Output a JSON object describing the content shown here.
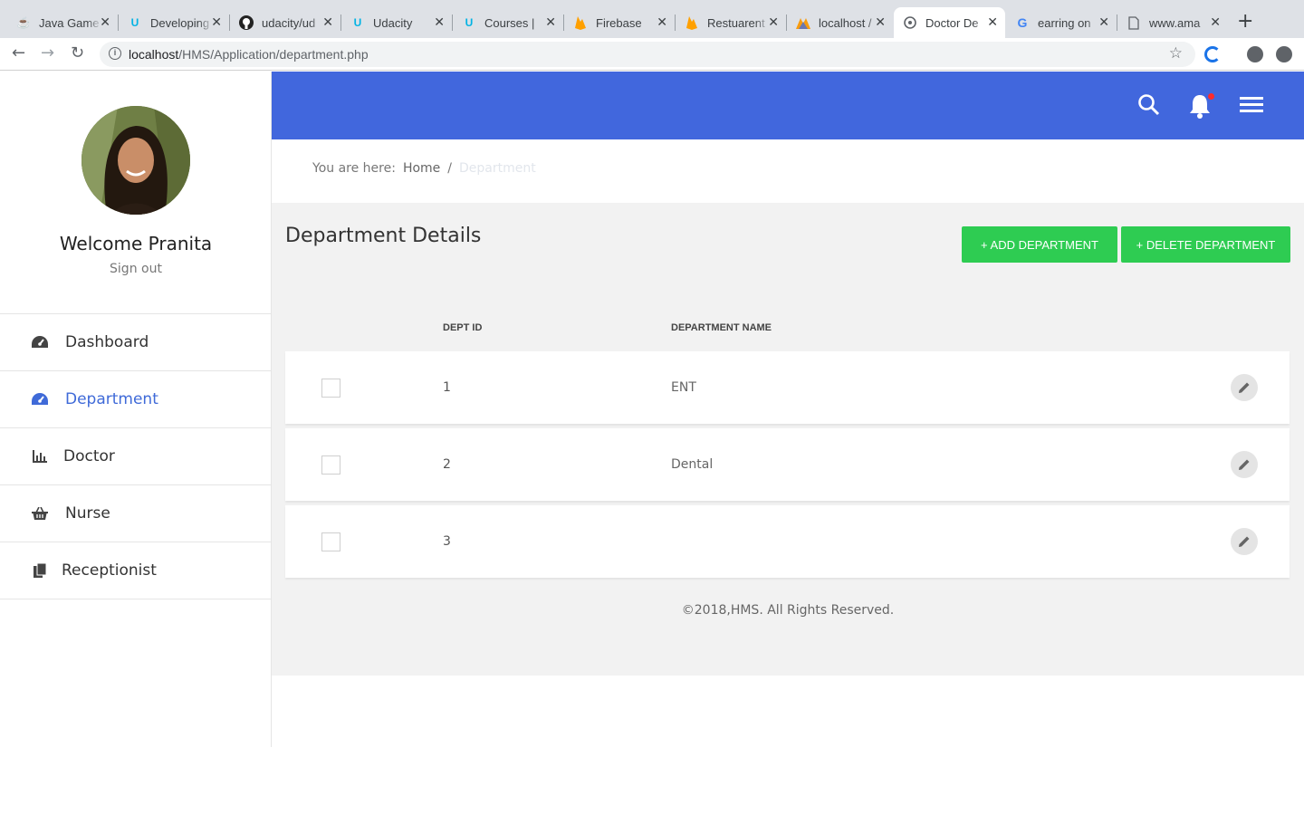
{
  "browser": {
    "tabs": [
      {
        "title": "Java Game",
        "icon": "java-icon"
      },
      {
        "title": "Developing",
        "icon": "udacity-icon"
      },
      {
        "title": "udacity/ud",
        "icon": "github-icon"
      },
      {
        "title": "Udacity",
        "icon": "udacity-icon"
      },
      {
        "title": "Courses |",
        "icon": "udacity-icon"
      },
      {
        "title": "Firebase",
        "icon": "firebase-icon"
      },
      {
        "title": "Restuarent",
        "icon": "firebase-icon"
      },
      {
        "title": "localhost /",
        "icon": "phpmyadmin-icon"
      },
      {
        "title": "Doctor De",
        "icon": "globe-icon"
      },
      {
        "title": "earring on",
        "icon": "google-icon"
      },
      {
        "title": "www.ama",
        "icon": "document-icon"
      }
    ],
    "url_host": "localhost",
    "url_path": "/HMS/Application/department.php"
  },
  "sidebar": {
    "welcome": "Welcome Pranita",
    "signout": "Sign out",
    "items": [
      {
        "label": "Dashboard",
        "icon": "dashboard-icon"
      },
      {
        "label": "Department",
        "icon": "dashboard-icon"
      },
      {
        "label": "Doctor",
        "icon": "bar-chart-icon"
      },
      {
        "label": "Nurse",
        "icon": "basket-icon"
      },
      {
        "label": "Receptionist",
        "icon": "files-icon"
      }
    ]
  },
  "breadcrumb": {
    "prefix": "You are here:",
    "home": "Home",
    "separator": "/",
    "current": "Department"
  },
  "main": {
    "title": "Department Details",
    "add_button": "+ ADD DEPARTMENT",
    "delete_button": "+ DELETE DEPARTMENT",
    "columns": [
      "DEPT ID",
      "DEPARTMENT NAME"
    ],
    "rows": [
      {
        "id": "1",
        "name": "ENT"
      },
      {
        "id": "2",
        "name": "Dental"
      },
      {
        "id": "3",
        "name": ""
      }
    ],
    "footer": "©2018,HMS. All Rights Reserved."
  },
  "colors": {
    "accent": "#4167dd",
    "button": "#2ecc52",
    "notification": "#ff2b2b"
  }
}
